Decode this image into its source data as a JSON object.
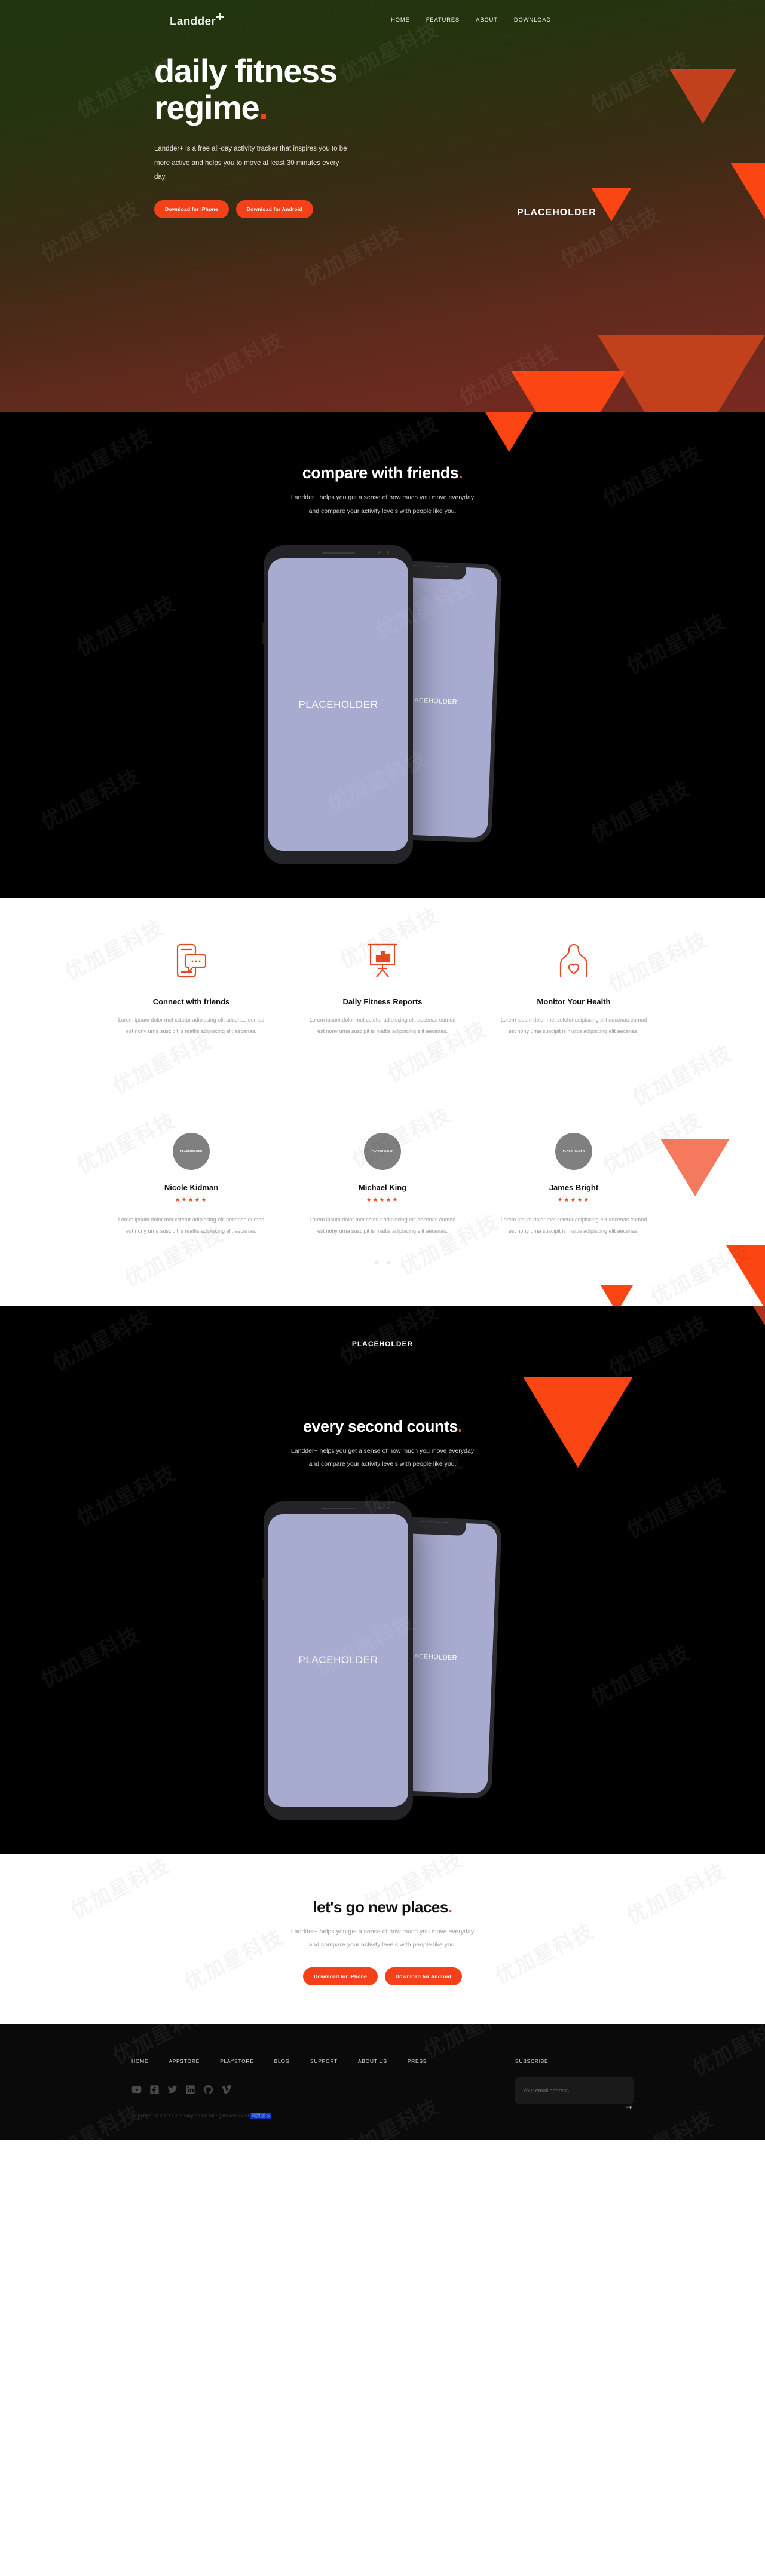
{
  "brand": {
    "name": "Landder",
    "plus_icon": "plus-icon"
  },
  "nav": {
    "items": [
      {
        "label": "HOME"
      },
      {
        "label": "FEATURES"
      },
      {
        "label": "ABOUT"
      },
      {
        "label": "DOWNLOAD"
      }
    ]
  },
  "hero": {
    "title_line1": "daily fitness",
    "title_line2": "regime",
    "title_dot": ".",
    "paragraph": "Landder+ is a free all-day activity tracker that inspires you to be more active and helps you to move at least 30 minutes every day.",
    "btn_iphone": "Download for iPhone",
    "btn_android": "Download for Android",
    "placeholder": "PLACEHOLDER"
  },
  "compare": {
    "title": "compare with friends",
    "title_dot": ".",
    "paragraph_line1": "Landder+ helps you get a sense of how much you move everyday",
    "paragraph_line2": "and compare your activity levels with people like you.",
    "phone_back_label": "PLACEHOLDER",
    "phone_front_label": "PLACEHOLDER"
  },
  "features": [
    {
      "icon": "phone-chat-icon",
      "title": "Connect with friends",
      "body": "Lorem ipsum dolor met cctetur adipiscing elit aecenas eumod est nony urna suscipit is mattis adipiscing elit aecenas."
    },
    {
      "icon": "presentation-chart-icon",
      "title": "Daily Fitness Reports",
      "body": "Lorem ipsum dolor met cctetur adipiscing elit aecenas eumod est nony urna suscipit is mattis adipiscing elit aecenas."
    },
    {
      "icon": "torso-heart-icon",
      "title": "Monitor Your Health",
      "body": "Lorem ipsum dolor met cctetur adipiscing elit aecenas eumod est nony urna suscipit is mattis adipiscing elit aecenas."
    }
  ],
  "testimonials": {
    "items": [
      {
        "avatar_label": "PLACEHOLDER",
        "name": "Nicole Kidman",
        "stars": "★★★★★",
        "rating": 5,
        "body": "Lorem ipsum dolor met cctetur adipiscing elit aecenas eumod est nony urna suscipit is mattis adipiscing elit aecenas."
      },
      {
        "avatar_label": "PLACEHOLDER",
        "name": "Michael King",
        "stars": "★★★★★",
        "rating": 5,
        "body": "Lorem ipsum dolor met cctetur adipiscing elit aecenas eumod est nony urna suscipit is mattis adipiscing elit aecenas."
      },
      {
        "avatar_label": "PLACEHOLDER",
        "name": "James Bright",
        "stars": "★★★★★",
        "rating": 5,
        "body": "Lorem ipsum dolor met cctetur adipiscing elit aecenas eumod est nony urna suscipit is mattis adipiscing elit aecenas."
      }
    ]
  },
  "seconds": {
    "top_placeholder": "PLACEHOLDER",
    "title": "every second counts",
    "title_dot": ".",
    "paragraph_line1": "Landder+ helps you get a sense of how much you move everyday",
    "paragraph_line2": "and compare your activity levels with people like you.",
    "phone_back_label": "PLACEHOLDER",
    "phone_front_label": "PLACEHOLDER"
  },
  "cta": {
    "title": "let's go new places",
    "title_dot": ".",
    "paragraph_line1": "Landder+ helps you get a sense of how much you move everyday",
    "paragraph_line2": "and compare your activity levels with people like you.",
    "btn_iphone": "Download for iPhone",
    "btn_android": "Download for Android"
  },
  "footer": {
    "links": [
      {
        "label": "HOME"
      },
      {
        "label": "APPSTORE"
      },
      {
        "label": "PLAYSTORE"
      },
      {
        "label": "BLOG"
      },
      {
        "label": "SUPPORT"
      },
      {
        "label": "ABOUT US"
      },
      {
        "label": "PRESS"
      }
    ],
    "social": [
      {
        "icon": "youtube-icon"
      },
      {
        "icon": "facebook-icon"
      },
      {
        "icon": "twitter-icon"
      },
      {
        "icon": "linkedin-icon"
      },
      {
        "icon": "github-icon"
      },
      {
        "icon": "vimeo-icon"
      }
    ],
    "subscribe_label": "SUBSCRIBE",
    "email_placeholder": "Your email address",
    "email_value": "",
    "submit_icon": "arrow-right-icon",
    "copyright": "Copyright © 2021.Company name All rights reserved.",
    "copyright_link": "网页模板"
  },
  "colors": {
    "accent": "#f4411a",
    "accent_soft": "#f5795c",
    "accent_dark": "#c2411c",
    "dark_bg": "#000000",
    "footer_bg": "#0a0a0a",
    "screen": "#a7abcf"
  }
}
